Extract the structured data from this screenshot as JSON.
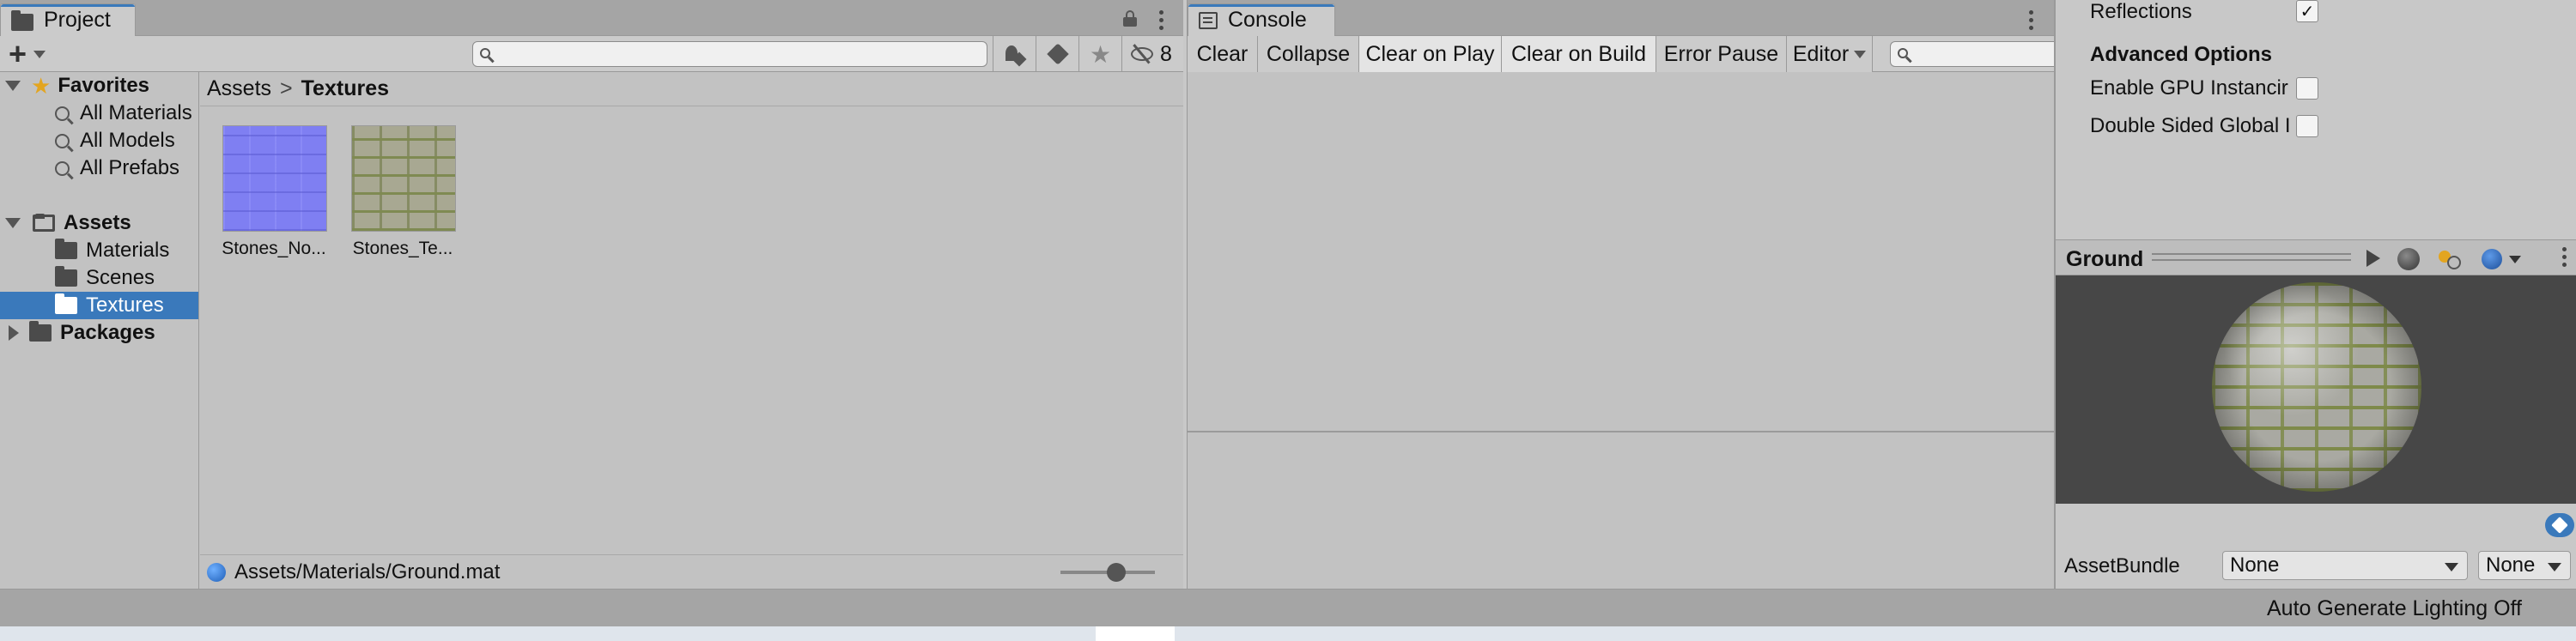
{
  "project_panel": {
    "tab_label": "Project",
    "add_label": "+",
    "search": {
      "placeholder": ""
    },
    "hidden_count": "8",
    "sidebar": {
      "favorites_label": "Favorites",
      "favorites": [
        "All Materials",
        "All Models",
        "All Prefabs"
      ],
      "assets_label": "Assets",
      "asset_folders": [
        "Materials",
        "Scenes",
        "Textures"
      ],
      "packages_label": "Packages"
    },
    "breadcrumb": {
      "root": "Assets",
      "current": "Textures",
      "separator": ">"
    },
    "assets": [
      {
        "name": "Stones_No...",
        "kind": "normal-map"
      },
      {
        "name": "Stones_Te...",
        "kind": "texture"
      }
    ],
    "status_path": "Assets/Materials/Ground.mat"
  },
  "console_panel": {
    "tab_label": "Console",
    "buttons": [
      "Clear",
      "Collapse",
      "Clear on Play",
      "Clear on Build",
      "Error Pause",
      "Editor"
    ],
    "search": {
      "placeholder": ""
    }
  },
  "inspector": {
    "reflections_label": "Reflections",
    "reflections_checked": "✓",
    "advanced_header": "Advanced Options",
    "gpu_label": "Enable GPU Instancir",
    "double_sided_label": "Double Sided Global I",
    "preview": {
      "title": "Ground"
    },
    "assetbundle_label": "AssetBundle",
    "assetbundle_value": "None",
    "assetbundle_variant": "None"
  },
  "status_bar": {
    "lighting_text": "Auto Generate Lighting Off"
  },
  "colors": {
    "selection": "#3a79bb",
    "panel_bg": "#c2c2c2",
    "preview_bg": "#474747"
  }
}
